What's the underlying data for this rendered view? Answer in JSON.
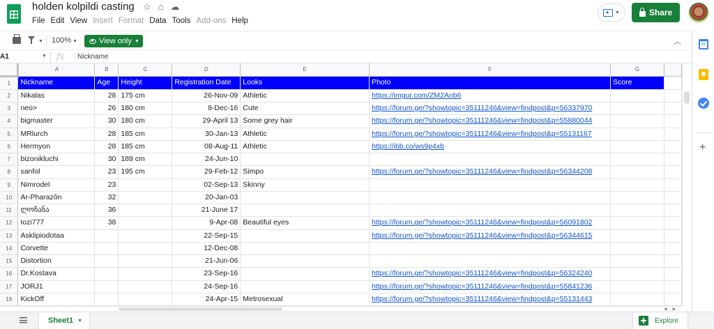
{
  "app": {
    "doc_title": "holden kolpildi casting",
    "menu": [
      "File",
      "Edit",
      "View",
      "Insert",
      "Format",
      "Data",
      "Tools",
      "Add-ons",
      "Help"
    ],
    "menu_disabled": [
      "Insert",
      "Format",
      "Add-ons"
    ],
    "share_label": "Share",
    "accent_color": "#188038"
  },
  "toolbar": {
    "zoom": "100%",
    "mode_label": "View only"
  },
  "formula_bar": {
    "cell_ref": "A1",
    "fx_label": "fx",
    "value": "Nickname"
  },
  "grid": {
    "column_letters": [
      "A",
      "B",
      "C",
      "D",
      "E",
      "F",
      "G"
    ],
    "header_fill": "#0000ff",
    "headers": [
      "Nickname",
      "Age",
      "Height",
      "Registration Date",
      "Looks",
      "Photo",
      "Score"
    ],
    "rows": [
      [
        "Nikalas",
        "28",
        "175 cm",
        "26-Nov-09",
        "Athletic",
        "https://imgur.com/ZM2Anb6",
        ""
      ],
      [
        "neo>",
        "26",
        "180 cm",
        "8-Dec-16",
        "Cute",
        "https://forum.ge/?showtopic=35111246&view=findpost&p=56337970",
        ""
      ],
      [
        "bigmaster",
        "30",
        "180 cm",
        "29-April 13",
        "Some grey hair",
        "https://forum.ge/?showtopic=35111246&view=findpost&p=55880044",
        ""
      ],
      [
        "MRlurch",
        "28",
        "185 cm",
        "30-Jan-13",
        "Athletic",
        "https://forum.ge/?showtopic=35111246&view=findpost&p=55131167",
        ""
      ],
      [
        "Hermyon",
        "28",
        "185 cm",
        "08-Aug-11",
        "Athletic",
        "https://ibb.co/ws9p4xb",
        ""
      ],
      [
        "bizonikluchi",
        "30",
        "189 cm",
        "24-Jun-10",
        "",
        "",
        ""
      ],
      [
        "sanfol",
        "23",
        "195 cm",
        "29-Feb-12",
        "Simpo",
        "https://forum.ge/?showtopic=35111246&view=findpost&p=56344208",
        ""
      ],
      [
        "Nimrodel",
        "23",
        "",
        "02-Sep-13",
        "Skinny",
        "",
        ""
      ],
      [
        "Ar-Pharazôn",
        "32",
        "",
        "20-Jan-03",
        "",
        "",
        ""
      ],
      [
        "ლოჩანა",
        "36",
        "",
        "21-June 17",
        "",
        "",
        ""
      ],
      [
        "tozi777",
        "38",
        "",
        "9-Apr-08",
        "Beautiful eyes",
        "https://forum.ge/?showtopic=35111246&view=findpost&p=56091802",
        ""
      ],
      [
        "Asklipiodotaa",
        "",
        "",
        "22-Sep-15",
        "",
        "https://forum.ge/?showtopic=35111246&view=findpost&p=56344615",
        ""
      ],
      [
        "Corvette",
        "",
        "",
        "12-Dec-08",
        "",
        "",
        ""
      ],
      [
        "Distortion",
        "",
        "",
        "21-Jun-06",
        "",
        "",
        ""
      ],
      [
        "Dr.Kostava",
        "",
        "",
        "23-Sep-16",
        "",
        "https://forum.ge/?showtopic=35111246&view=findpost&p=56324240",
        ""
      ],
      [
        "JORJ1",
        "",
        "",
        "24-Sep-16",
        "",
        "https://forum.ge/?showtopic=35111246&view=findpost&p=55841236",
        ""
      ],
      [
        "KickOff",
        "",
        "",
        "24-Apr-15",
        "Metrosexual",
        "https://forum.ge/?showtopic=35111246&view=findpost&p=55131443",
        ""
      ]
    ]
  },
  "bottom": {
    "sheet_tab": "Sheet1",
    "explore_label": "Explore"
  }
}
